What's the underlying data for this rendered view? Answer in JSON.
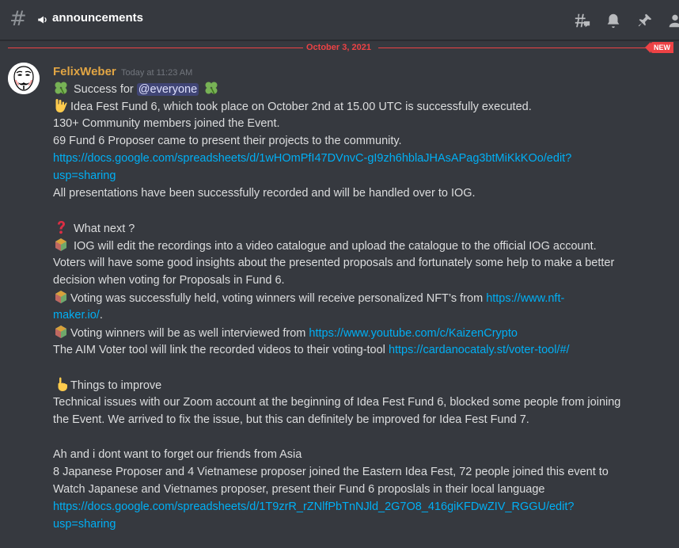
{
  "channel": {
    "name": "announcements"
  },
  "header_icons": [
    "threads-icon",
    "bell-icon",
    "pin-icon",
    "member-list-icon"
  ],
  "divider": {
    "date": "October 3, 2021",
    "badge": "NEW"
  },
  "message": {
    "author": "FelixWeber",
    "timestamp": "Today at 11:23 AM",
    "author_color": "#e1a544",
    "success_prefix": "Success for",
    "mention": "@everyone",
    "line_idea": "Idea Fest Fund 6, which took place on October 2nd at 15.00 UTC is successfully executed.",
    "line_members": "130+ Community members joined the Event.",
    "line_proposers": "69 Fund 6 Proposer came to present their projects to the community.",
    "link1_a": "https://docs.google.com/spreadsheets/d/1wHOmPfI47DVnvC-gI9zh6hblaJHAsAPag3btMiKkKOo/edit?",
    "link1_b": "usp=sharing",
    "line_recorded": "All presentations have been successfully recorded and will be handled over to IOG.",
    "whats_next": "What next ?",
    "iog_edit": "IOG will edit the recordings into a video catalogue and upload the catalogue to the official IOG account.",
    "voters_a": "Voters will have some good insights about the presented proposals and fortunately some help to make a better",
    "voters_b": "decision when voting for Proposals in Fund 6.",
    "voting_held": "Voting was successfully held, voting winners will receive personalized NFT’s from",
    "nft_link_a": "https://www.nft-",
    "nft_link_b": "maker.io/",
    "nft_suffix": ".",
    "interviewed": "Voting winners will be as well interviewed from",
    "youtube_link": "https://www.youtube.com/c/KaizenCrypto",
    "aim_tool": "The AIM Voter tool will link the recorded videos to their voting-tool",
    "voter_link": "https://cardanocataly.st/voter-tool/#/",
    "improve": "Things to improve",
    "tech_a": "Technical issues with our Zoom account at the beginning of Idea Fest Fund 6, blocked some people from joining",
    "tech_b": "the Event. We arrived to fix the issue, but this can definitely be improved for Idea Fest Fund 7.",
    "asia": "Ah and i dont want to forget our friends from Asia",
    "jp_a": "8 Japanese Proposer and 4 Vietnamese proposer joined the Eastern Idea Fest, 72 people joined this event to",
    "jp_b": "Watch Japanese and Vietnames proposer, present their Fund 6 proposlals in their local language",
    "link2_a": "https://docs.google.com/spreadsheets/d/1T9zrR_rZNlfPbTnNJld_2G7O8_416giKFDwZIV_RGGU/edit?",
    "link2_b": "usp=sharing"
  },
  "colors": {
    "background": "#36393f",
    "link": "#00aff4",
    "new_divider": "#ed4245",
    "mention_bg": "#3c4270"
  }
}
